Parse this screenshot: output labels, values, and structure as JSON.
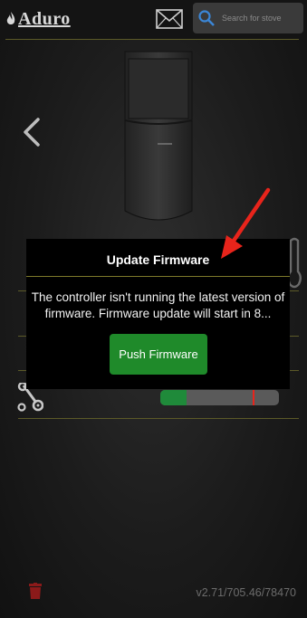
{
  "header": {
    "logo_text": "Aduro",
    "search_placeholder": "Search for stove"
  },
  "modal": {
    "title": "Update Firmware",
    "message": "The controller isn't running the latest version of firmware. Firmware update will start in 8...",
    "button_label": "Push Firmware"
  },
  "status_bar": {
    "fill_fraction": 0.22,
    "marker_fraction": 0.78
  },
  "footer": {
    "version": "v2.71/705.46/78470"
  },
  "colors": {
    "accent_line": "#5c5a28",
    "button_green": "#1f8a2a",
    "annotation_arrow": "#e8241b",
    "trash_red": "#8b1a1a"
  },
  "icons": [
    "aduro-flame-logo",
    "mail-icon",
    "search-icon",
    "back-chevron-icon",
    "stove-image",
    "thermometer-icon",
    "tools-icon",
    "trash-icon",
    "annotation-arrow"
  ]
}
